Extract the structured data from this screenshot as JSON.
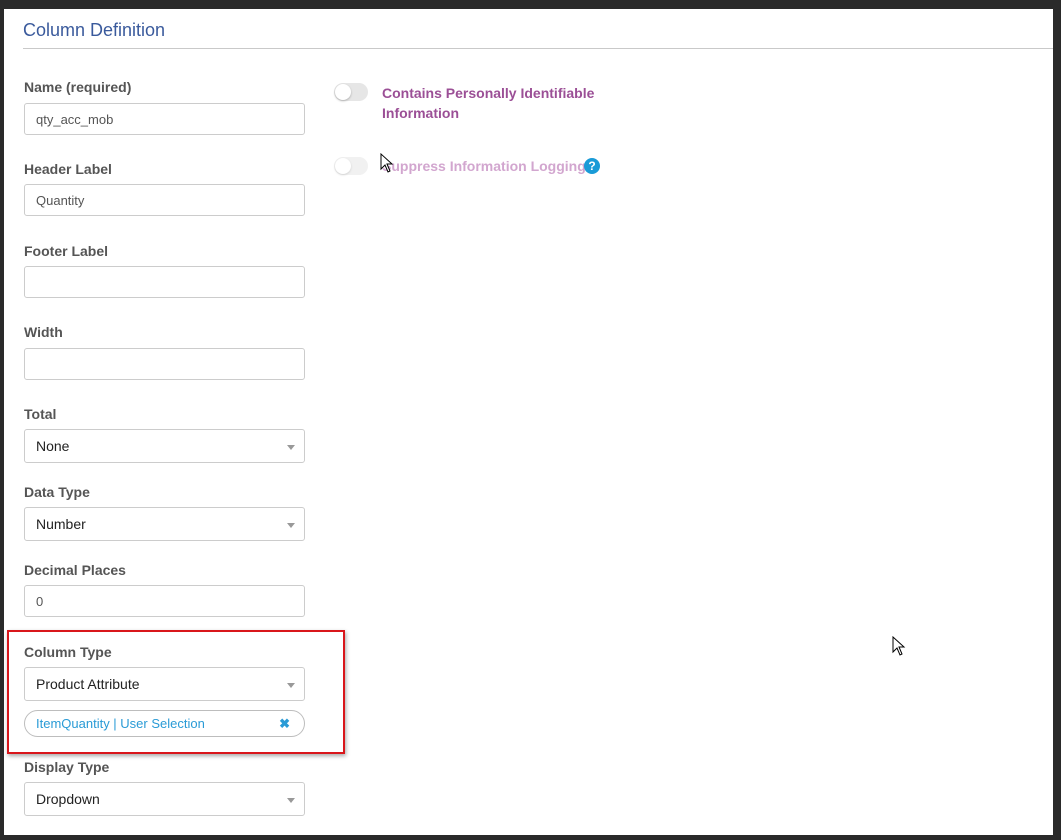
{
  "section": {
    "title": "Column Definition"
  },
  "fields": {
    "name": {
      "label": "Name (required)",
      "value": "qty_acc_mob"
    },
    "header_label": {
      "label": "Header Label",
      "value": "Quantity"
    },
    "footer_label": {
      "label": "Footer Label",
      "value": ""
    },
    "width": {
      "label": "Width",
      "value": ""
    },
    "total": {
      "label": "Total",
      "value": "None"
    },
    "data_type": {
      "label": "Data Type",
      "value": "Number"
    },
    "decimal_places": {
      "label": "Decimal Places",
      "value": "0"
    },
    "column_type": {
      "label": "Column Type",
      "value": "Product Attribute"
    },
    "column_type_tag": {
      "text": "ItemQuantity | User Selection",
      "remove_icon": "✖"
    },
    "display_type": {
      "label": "Display Type",
      "value": "Dropdown"
    }
  },
  "toggles": {
    "pii": {
      "label_line1": "Contains Personally Identifiable",
      "label_line2": "Information",
      "on": false
    },
    "suppress": {
      "label": "Suppress Information Logging",
      "on": false,
      "disabled": true,
      "help": "?"
    }
  },
  "colors": {
    "title": "#3a5a9c",
    "toggle_label": "#9b4f96",
    "tag_text": "#2a9bd6",
    "highlight": "#d9161b",
    "help_icon": "#1a9bd7"
  }
}
